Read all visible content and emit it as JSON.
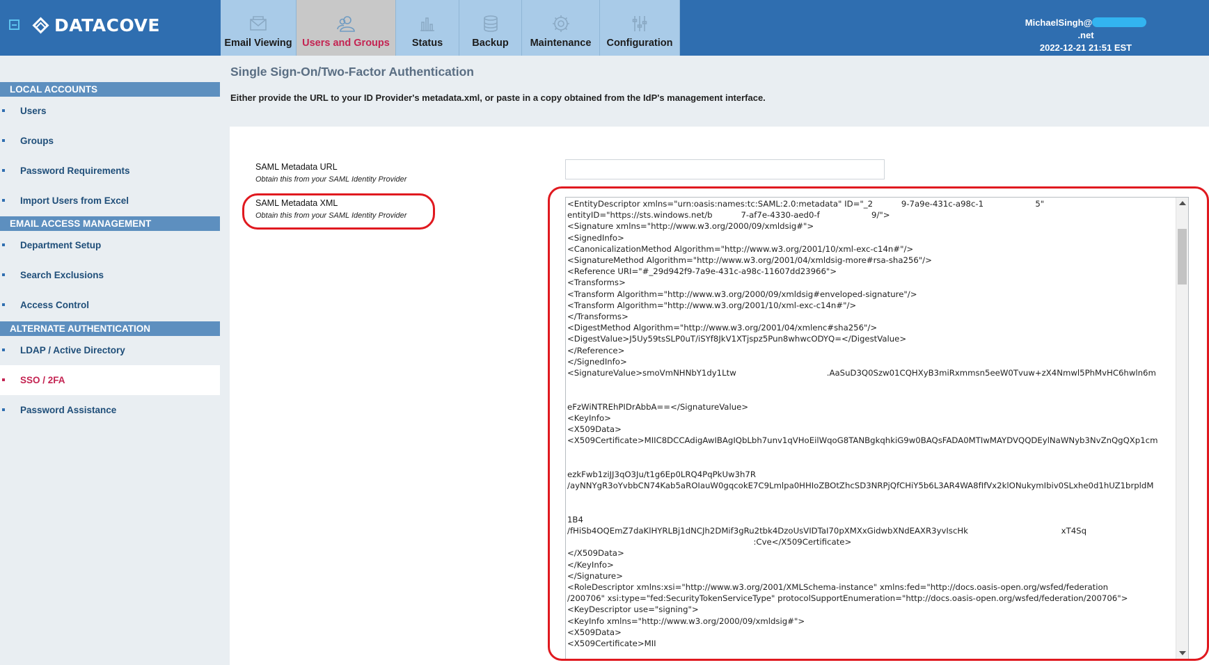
{
  "header": {
    "logo": "DATACOVE",
    "user_prefix": "MichaelSingh@",
    "user_suffix": ".net",
    "datetime": "2022-12-21 21:51 EST",
    "tabs": [
      {
        "label": "Email Viewing",
        "icon": "envelope-icon"
      },
      {
        "label": "Users and Groups",
        "icon": "users-icon"
      },
      {
        "label": "Status",
        "icon": "bar-chart-icon"
      },
      {
        "label": "Backup",
        "icon": "database-icon"
      },
      {
        "label": "Maintenance",
        "icon": "gear-icon"
      },
      {
        "label": "Configuration",
        "icon": "sliders-icon"
      }
    ],
    "active_tab": "Users and Groups"
  },
  "sidebar": {
    "sections": [
      {
        "title": "LOCAL ACCOUNTS",
        "items": [
          "Users",
          "Groups",
          "Password Requirements",
          "Import Users from Excel"
        ]
      },
      {
        "title": "EMAIL ACCESS MANAGEMENT",
        "items": [
          "Department Setup",
          "Search Exclusions",
          "Access Control"
        ]
      },
      {
        "title": "ALTERNATE AUTHENTICATION",
        "items": [
          "LDAP / Active Directory",
          "SSO / 2FA",
          "Password Assistance"
        ]
      }
    ],
    "active_item": "SSO / 2FA"
  },
  "main": {
    "title": "Single Sign-On/Two-Factor Authentication",
    "description": "Either provide the URL to your ID Provider's metadata.xml, or paste in a copy obtained from the IdP's management interface.",
    "url_field": {
      "label": "SAML Metadata URL",
      "hint": "Obtain this from your SAML Identity Provider",
      "value": ""
    },
    "xml_field": {
      "label": "SAML Metadata XML",
      "hint": "Obtain this from your SAML Identity Provider",
      "lines": [
        "<EntityDescriptor xmlns=\"urn:oasis:names:tc:SAML:2.0:metadata\" ID=\"_2           9-7a9e-431c-a98c-1                    5\"",
        "entityID=\"https://sts.windows.net/b           7-af7e-4330-aed0-f                    9/\">",
        "<Signature xmlns=\"http://www.w3.org/2000/09/xmldsig#\">",
        "<SignedInfo>",
        "<CanonicalizationMethod Algorithm=\"http://www.w3.org/2001/10/xml-exc-c14n#\"/>",
        "<SignatureMethod Algorithm=\"http://www.w3.org/2001/04/xmldsig-more#rsa-sha256\"/>",
        "<Reference URI=\"#_29d942f9-7a9e-431c-a98c-11607dd23966\">",
        "<Transforms>",
        "<Transform Algorithm=\"http://www.w3.org/2000/09/xmldsig#enveloped-signature\"/>",
        "<Transform Algorithm=\"http://www.w3.org/2001/10/xml-exc-c14n#\"/>",
        "</Transforms>",
        "<DigestMethod Algorithm=\"http://www.w3.org/2001/04/xmlenc#sha256\"/>",
        "<DigestValue>J5Uy59tsSLP0uT/iSYf8JkV1XTjspz5Pun8whwcODYQ=</DigestValue>",
        "</Reference>",
        "</SignedInfo>",
        "<SignatureValue>smoVmNHNbY1dy1Ltw                                   .AaSuD3Q0Szw01CQHXyB3miRxmmsn5eeW0Tvuw+zX4Nmwl5PhMvHC6hwln6m",
        "",
        "",
        "eFzWiNTREhPIDrAbbA==</SignatureValue>",
        "<KeyInfo>",
        "<X509Data>",
        "<X509Certificate>MIIC8DCCAdigAwIBAgIQbLbh7unv1qVHoEilWqoG8TANBgkqhkiG9w0BAQsFADA0MTIwMAYDVQQDEylNaWNyb3NvZnQgQXp1cm",
        "",
        "",
        "ezkFwb1ziJJ3qO3Ju/t1g6Ep0LRQ4PqPkUw3h7R",
        "/ayNNYgR3oYvbbCN74Kab5aROIauW0gqcokE7C9Lmlpa0HHIoZBOtZhcSD3NRPjQfCHiY5b6L3AR4WA8fIfVx2klONukymIbiv0SLxhe0d1hUZ1brpldM",
        "",
        "",
        "1B4",
        "/fHiSb4OQEmZ7daKlHYRLBj1dNCJh2DMif3gRu2tbk4DzoUsVIDTaI70pXMXxGidwbXNdEAXR3yvIscHk                                    xT4Sq",
        "                                                                        :Cve</X509Certificate>",
        "</X509Data>",
        "</KeyInfo>",
        "</Signature>",
        "<RoleDescriptor xmlns:xsi=\"http://www.w3.org/2001/XMLSchema-instance\" xmlns:fed=\"http://docs.oasis-open.org/wsfed/federation",
        "/200706\" xsi:type=\"fed:SecurityTokenServiceType\" protocolSupportEnumeration=\"http://docs.oasis-open.org/wsfed/federation/200706\">",
        "<KeyDescriptor use=\"signing\">",
        "<KeyInfo xmlns=\"http://www.w3.org/2000/09/xmldsig#\">",
        "<X509Data>",
        "<X509Certificate>MII"
      ]
    }
  },
  "colors": {
    "header": "#2f6eb0",
    "active_accent": "#c42452",
    "annotation": "#e0191f",
    "redaction": "#33b4f0"
  }
}
